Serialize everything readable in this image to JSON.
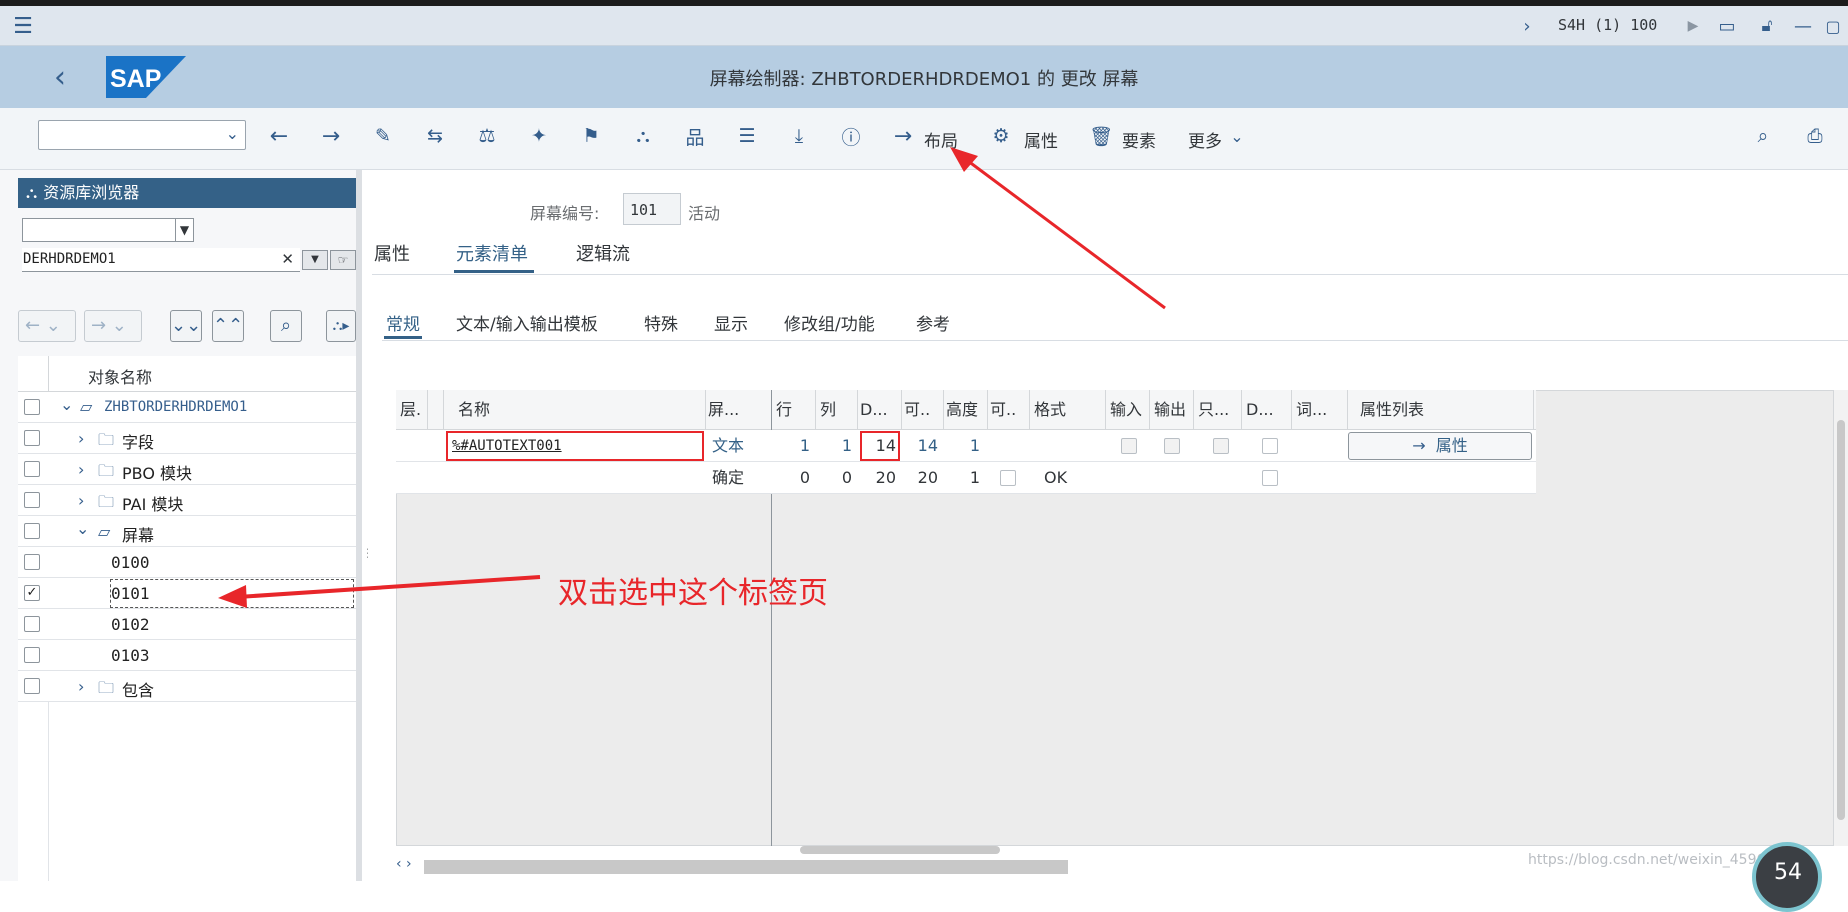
{
  "menubar": {
    "system_info": "S4H (1) 100"
  },
  "titlebar": {
    "logo": "SAP",
    "title": "屏幕绘制器: ZHBTORDERHDRDEMO1 的 更改 屏幕"
  },
  "toolbar": {
    "layout_label": "布局",
    "attributes_label": "属性",
    "elements_label": "要素",
    "more_label": "更多"
  },
  "left": {
    "header": "资源库浏览器",
    "object_value": "DERHDRDEMO1",
    "column_header": "对象名称",
    "tree": [
      {
        "label": "ZHBTORDERHDRDEMO1"
      },
      {
        "label": "字段"
      },
      {
        "label": "PBO 模块"
      },
      {
        "label": "PAI 模块"
      },
      {
        "label": "屏幕"
      },
      {
        "label": "0100"
      },
      {
        "label": "0101"
      },
      {
        "label": "0102"
      },
      {
        "label": "0103"
      },
      {
        "label": "包含"
      }
    ]
  },
  "screen": {
    "number_label": "屏幕编号:",
    "number_value": "101",
    "status": "活动",
    "tabs": [
      "属性",
      "元素清单",
      "逻辑流"
    ],
    "subtabs": [
      "常规",
      "文本/输入输出模板",
      "特殊",
      "显示",
      "修改组/功能",
      "参考"
    ]
  },
  "table": {
    "headers": [
      "层.",
      "名称",
      "屏...",
      "行",
      "列",
      "D...",
      "可..",
      "高度",
      "可..",
      "格式",
      "输入",
      "输出",
      "只...",
      "D...",
      "词...",
      "属性列表"
    ],
    "rows": [
      {
        "name": "%#AUTOTEXT001",
        "type": "文本",
        "row": "1",
        "col": "1",
        "d": "14",
        "vis": "14",
        "height": "1",
        "format": "",
        "button": "属性"
      },
      {
        "name": "",
        "type": "确定",
        "row": "0",
        "col": "0",
        "d": "20",
        "vis": "20",
        "height": "1",
        "format": "OK",
        "button": ""
      }
    ]
  },
  "annotation": {
    "text": "双击选中这个标签页",
    "color": "#e8262a"
  },
  "watermark": "https://blog.csdn.net/weixin_45963929",
  "badge": "54"
}
